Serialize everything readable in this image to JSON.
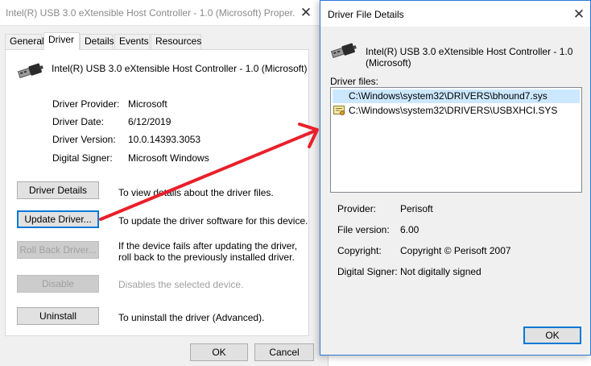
{
  "properties_window": {
    "title": "Intel(R) USB 3.0 eXtensible Host Controller - 1.0 (Microsoft) Proper...",
    "tabs": [
      {
        "label": "General"
      },
      {
        "label": "Driver"
      },
      {
        "label": "Details"
      },
      {
        "label": "Events"
      },
      {
        "label": "Resources"
      }
    ],
    "active_tab": "Driver",
    "device_icon": "usb-plug-icon",
    "device_name": "Intel(R) USB 3.0 eXtensible Host Controller - 1.0 (Microsoft)",
    "info": [
      {
        "label": "Driver Provider:",
        "value": "Microsoft"
      },
      {
        "label": "Driver Date:",
        "value": "6/12/2019"
      },
      {
        "label": "Driver Version:",
        "value": "10.0.14393.3053"
      },
      {
        "label": "Digital Signer:",
        "value": "Microsoft Windows"
      }
    ],
    "actions": [
      {
        "button": "Driver Details",
        "description": "To view details about the driver files.",
        "enabled": true
      },
      {
        "button": "Update Driver...",
        "description": "To update the driver software for this device.",
        "enabled": true
      },
      {
        "button": "Roll Back Driver...",
        "description": "If the device fails after updating the driver, roll back to the previously installed driver.",
        "enabled": false
      },
      {
        "button": "Disable",
        "description": "Disables the selected device.",
        "enabled": false
      },
      {
        "button": "Uninstall",
        "description": "To uninstall the driver (Advanced).",
        "enabled": true
      }
    ],
    "ok_label": "OK",
    "cancel_label": "Cancel"
  },
  "details_window": {
    "title": "Driver File Details",
    "device_icon": "usb-plug-icon",
    "device_name_line1": "Intel(R) USB 3.0 eXtensible Host Controller - 1.0",
    "device_name_line2": "(Microsoft)",
    "files_label": "Driver files:",
    "files": [
      {
        "path": "C:\\Windows\\system32\\DRIVERS\\bhound7.sys",
        "selected": true,
        "icon": null
      },
      {
        "path": "C:\\Windows\\system32\\DRIVERS\\USBXHCI.SYS",
        "selected": false,
        "icon": "certificate-icon"
      }
    ],
    "info": [
      {
        "label": "Provider:",
        "value": "Perisoft"
      },
      {
        "label": "File version:",
        "value": "6.00"
      },
      {
        "label": "Copyright:",
        "value": "Copyright © Perisoft 2007"
      },
      {
        "label": "Digital Signer:",
        "value": "Not digitally signed"
      }
    ],
    "ok_label": "OK"
  },
  "annotation": {
    "color": "#e8202a",
    "icon": "red-arrow-annotation"
  },
  "colors": {
    "focus_blue": "#0078d7",
    "selection": "#cce8ff"
  }
}
